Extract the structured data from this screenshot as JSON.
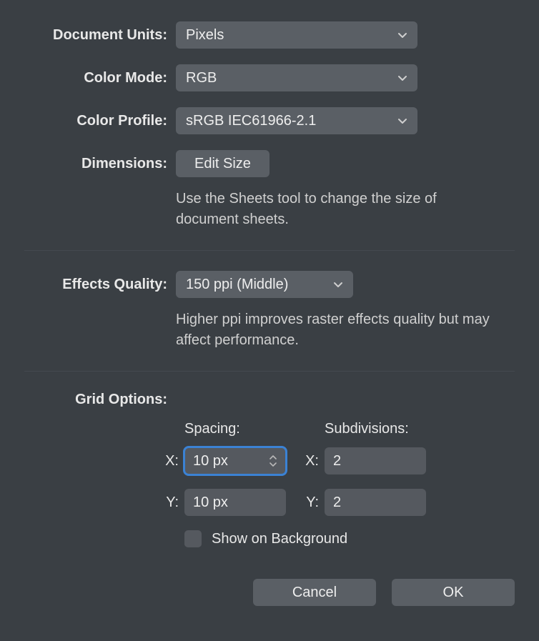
{
  "labels": {
    "document_units": "Document Units:",
    "color_mode": "Color Mode:",
    "color_profile": "Color Profile:",
    "dimensions": "Dimensions:",
    "effects_quality": "Effects Quality:",
    "grid_options": "Grid Options:",
    "spacing": "Spacing:",
    "subdivisions": "Subdivisions:",
    "x": "X:",
    "y": "Y:",
    "show_on_background": "Show on Background"
  },
  "values": {
    "document_units": "Pixels",
    "color_mode": "RGB",
    "color_profile": "sRGB IEC61966-2.1",
    "effects_quality": "150 ppi (Middle)",
    "spacing_x": "10 px",
    "spacing_y": "10 px",
    "subdiv_x": "2",
    "subdiv_y": "2"
  },
  "buttons": {
    "edit_size": "Edit Size",
    "cancel": "Cancel",
    "ok": "OK"
  },
  "help": {
    "dimensions": "Use the Sheets tool to change the size of document sheets.",
    "effects": "Higher ppi improves raster effects quality but may affect performance."
  }
}
